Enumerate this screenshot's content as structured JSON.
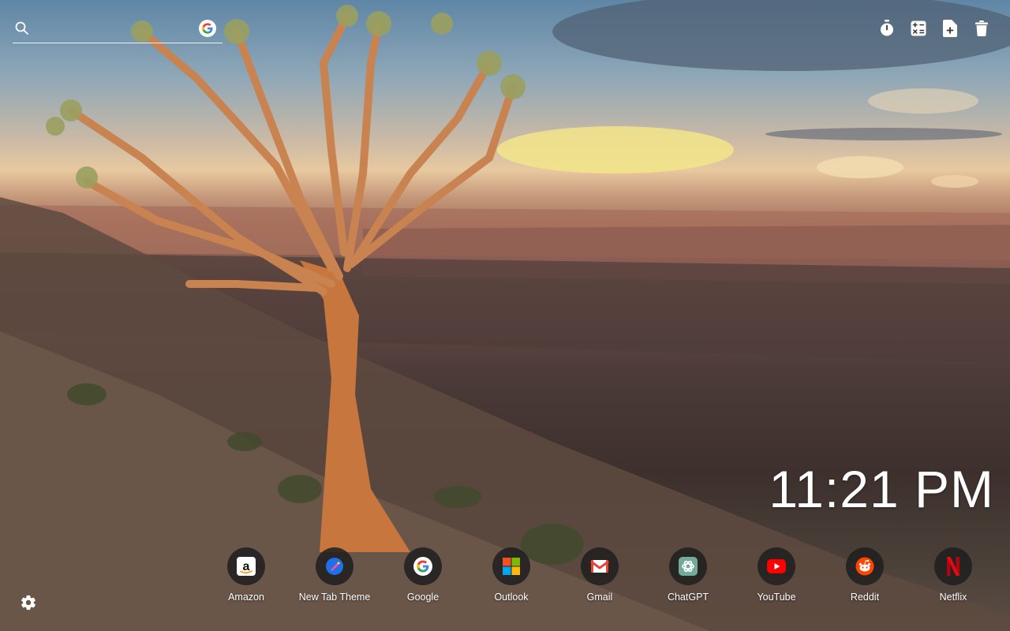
{
  "search": {
    "placeholder": "",
    "value": "",
    "engine_icon": "google-g-icon"
  },
  "toolbar": {
    "items": [
      {
        "name": "stopwatch-icon"
      },
      {
        "name": "calculator-icon"
      },
      {
        "name": "new-document-icon"
      },
      {
        "name": "trash-icon"
      }
    ]
  },
  "clock": {
    "time": "11:21 PM"
  },
  "shortcuts": [
    {
      "label": "Amazon",
      "icon": "amazon-icon"
    },
    {
      "label": "New Tab Theme",
      "icon": "new-tab-theme-icon"
    },
    {
      "label": "Google",
      "icon": "google-icon"
    },
    {
      "label": "Outlook",
      "icon": "outlook-icon"
    },
    {
      "label": "Gmail",
      "icon": "gmail-icon"
    },
    {
      "label": "ChatGPT",
      "icon": "chatgpt-icon"
    },
    {
      "label": "YouTube",
      "icon": "youtube-icon"
    },
    {
      "label": "Reddit",
      "icon": "reddit-icon"
    },
    {
      "label": "Netflix",
      "icon": "netflix-icon"
    }
  ],
  "settings": {
    "icon": "gear-icon"
  },
  "colors": {
    "text": "#ffffff",
    "shortcut_bg": "#1e1e1e",
    "youtube": "#ff0000",
    "reddit": "#ff4500",
    "netflix": "#e50914",
    "new_tab_theme": "#1e6fe8"
  }
}
